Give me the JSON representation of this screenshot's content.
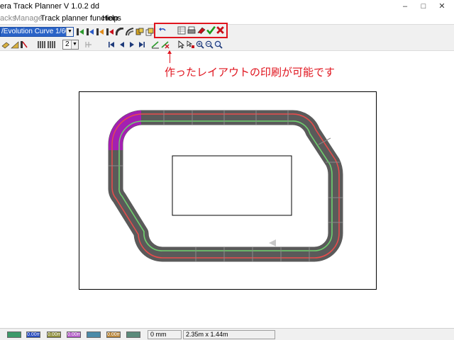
{
  "window": {
    "title": "era Track Planner V 1.0.2 dd",
    "minimize": "–",
    "maximize": "□",
    "close": "✕"
  },
  "menu": {
    "items": [
      {
        "label": "acks",
        "enabled": false
      },
      {
        "label": "Manage",
        "enabled": false
      },
      {
        "label": "Track planner functions",
        "enabled": true
      },
      {
        "label": "Help",
        "enabled": true
      }
    ]
  },
  "toolbar": {
    "track_select": "/Evolution Curve 1/60-",
    "lane_select": "2",
    "icons": [
      "add-track-icon",
      "reverse-track-icon",
      "flip-track-icon",
      "delete-track-icon",
      "curve-icon",
      "lane-change-icon",
      "rotate-icon",
      "undo-icon",
      "list-icon",
      "print-preview-icon",
      "print-icon",
      "eraser-icon",
      "confirm-icon",
      "cancel-icon",
      "first-icon",
      "prev-icon",
      "next-icon",
      "last-icon",
      "pointer-icon",
      "zoom-in-icon",
      "zoom-out-icon",
      "zoom-fit-icon"
    ],
    "colors": {
      "confirm": "#1a9a1a",
      "cancel": "#c8101a"
    }
  },
  "annotation": {
    "text": "作ったレイアウトの印刷が可能です",
    "color": "#e0141e"
  },
  "plan": {
    "track_color": "#5a5a5a",
    "selected_color": "#a41fb2",
    "lane_colors": [
      "#e74c4c",
      "#6fd26f"
    ],
    "arrow": "◀"
  },
  "status": {
    "swatches": [
      {
        "label": "",
        "color": "#3d9a6a"
      },
      {
        "label": "0.00m",
        "color": "#2a4fbd"
      },
      {
        "label": "0.00m",
        "color": "#8d8d3a"
      },
      {
        "label": "0.00m",
        "color": "#b25ac7"
      },
      {
        "label": "",
        "color": "#4a8aa8"
      },
      {
        "label": "0.00m",
        "color": "#b8863a"
      },
      {
        "label": "",
        "color": "#5a8a7a"
      }
    ],
    "length": "0 mm",
    "size": "2.35m x 1.44m"
  }
}
